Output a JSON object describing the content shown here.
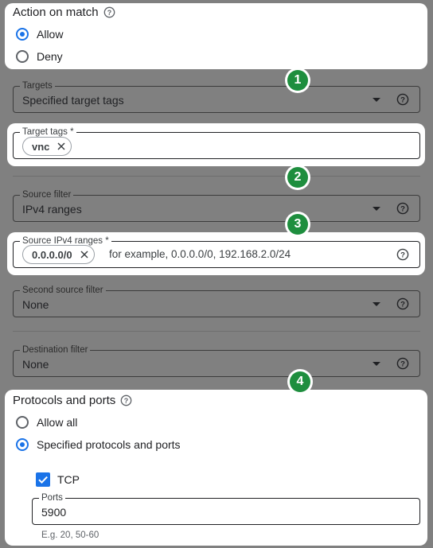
{
  "action": {
    "title": "Action on match",
    "help_icon": "help-circle-icon",
    "options": [
      {
        "label": "Allow",
        "selected": true
      },
      {
        "label": "Deny",
        "selected": false
      }
    ]
  },
  "targets": {
    "label": "Targets",
    "value": "Specified target tags"
  },
  "target_tags": {
    "label": "Target tags *",
    "chips": [
      "vnc"
    ]
  },
  "source_filter": {
    "label": "Source filter",
    "value": "IPv4 ranges"
  },
  "source_ranges": {
    "label": "Source IPv4 ranges *",
    "chips": [
      "0.0.0.0/0"
    ],
    "placeholder": "for example, 0.0.0.0/0, 192.168.2.0/24"
  },
  "second_source_filter": {
    "label": "Second source filter",
    "value": "None"
  },
  "destination_filter": {
    "label": "Destination filter",
    "value": "None"
  },
  "protocols": {
    "title": "Protocols and ports",
    "options": [
      {
        "label": "Allow all",
        "selected": false
      },
      {
        "label": "Specified protocols and ports",
        "selected": true
      }
    ],
    "tcp": {
      "label": "TCP",
      "checked": true
    },
    "ports": {
      "label": "Ports",
      "value": "5900",
      "hint": "E.g. 20, 50-60"
    }
  },
  "badges": [
    "1",
    "2",
    "3",
    "4"
  ],
  "colors": {
    "accent": "#1a73e8",
    "badge": "#1e8e3e",
    "overlay": "#808080"
  }
}
